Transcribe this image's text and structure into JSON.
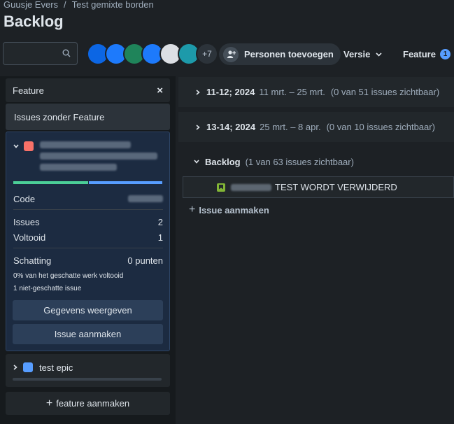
{
  "breadcrumb": {
    "owner": "Guusje Evers",
    "separator": "/",
    "board": "Test gemixte borden"
  },
  "page_title": "Backlog",
  "search": {
    "placeholder": ""
  },
  "avatars": {
    "more": "+7",
    "colors": [
      "#0c66e4",
      "#1d7afc",
      "#1f845a",
      "#1d7afc",
      "#dcdfe4",
      "#1d9aaa"
    ]
  },
  "toolbar": {
    "add_people": "Personen toevoegen",
    "version": "Versie",
    "feature": "Feature",
    "feature_count": "1"
  },
  "sidebar": {
    "title": "Feature",
    "close": "×",
    "no_feature": "Issues zonder Feature",
    "card": {
      "progress_done_fraction": 0.5,
      "code_label": "Code",
      "issues_label": "Issues",
      "issues_value": "2",
      "done_label": "Voltooid",
      "done_value": "1",
      "estimate_label": "Schatting",
      "estimate_value": "0 punten",
      "note1": "0% van het geschatte werk voltooid",
      "note2": "1 niet-geschatte issue",
      "details_button": "Gegevens weergeven",
      "create_issue_button": "Issue aanmaken"
    },
    "epic": {
      "label": "test epic"
    },
    "add_feature": "feature aanmaken"
  },
  "sprints": [
    {
      "name": "11-12; 2024",
      "dates": "11 mrt. – 25 mrt.",
      "count": "(0 van 51 issues zichtbaar)"
    },
    {
      "name": "13-14; 2024",
      "dates": "25 mrt. – 8 apr.",
      "count": "(0 van 10 issues zichtbaar)"
    }
  ],
  "backlog": {
    "name": "Backlog",
    "count": "(1 van 63 issues zichtbaar)"
  },
  "issue": {
    "summary": "TEST WORDT VERWIJDERD"
  },
  "create_issue": "Issue aanmaken"
}
